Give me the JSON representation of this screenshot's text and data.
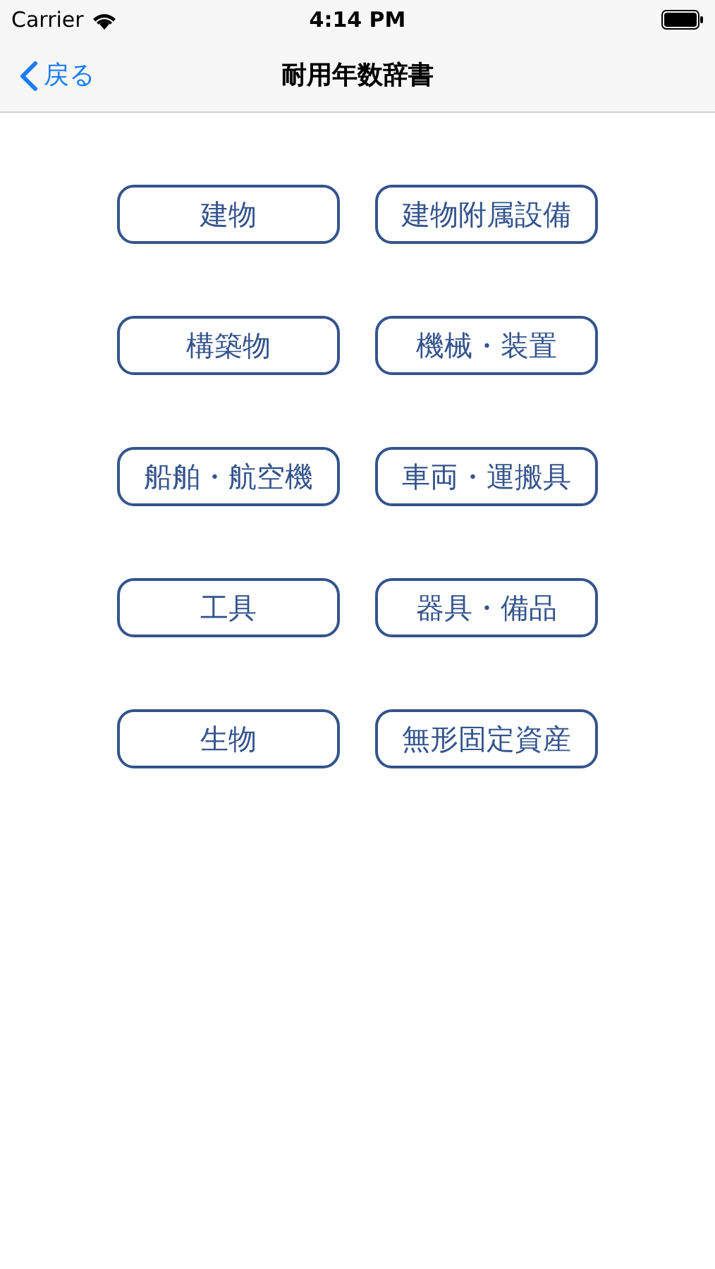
{
  "status_bar": {
    "carrier": "Carrier",
    "time": "4:14 PM"
  },
  "nav_bar": {
    "back": "戻る",
    "title": "耐用年数辞書"
  },
  "categories": [
    {
      "label": "建物"
    },
    {
      "label": "建物附属設備"
    },
    {
      "label": "構築物"
    },
    {
      "label": "機械・装置"
    },
    {
      "label": "船舶・航空機"
    },
    {
      "label": "車両・運搬具"
    },
    {
      "label": "工具"
    },
    {
      "label": "器具・備品"
    },
    {
      "label": "生物"
    },
    {
      "label": "無形固定資産"
    }
  ]
}
